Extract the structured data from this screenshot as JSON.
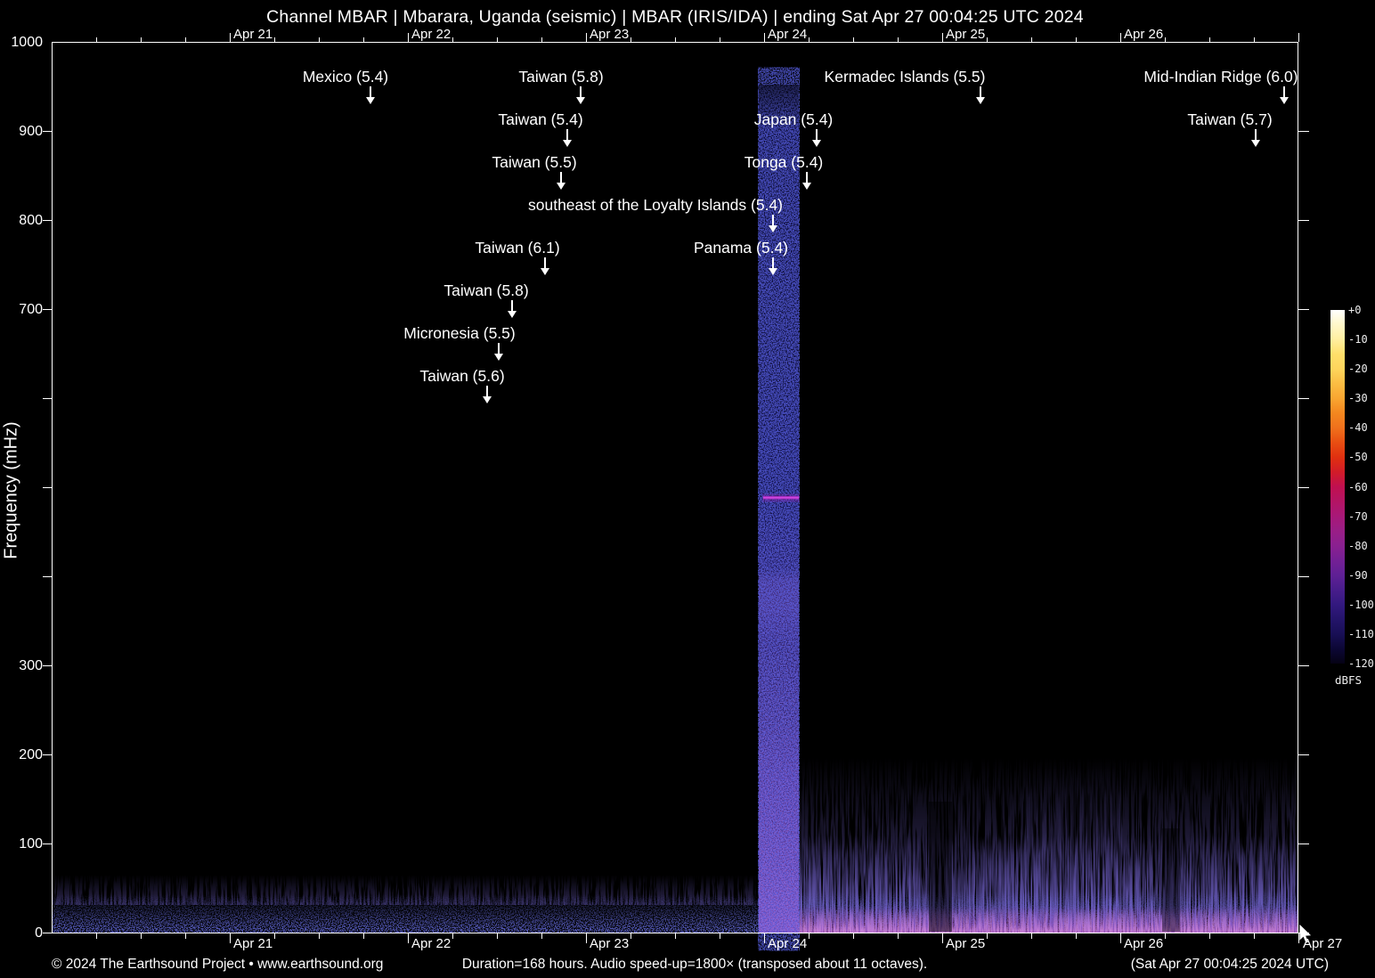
{
  "title": "Channel MBAR | Mbarara, Uganda (seismic) | MBAR (IRIS/IDA) | ending Sat Apr 27 00:04:25 UTC 2024",
  "y_axis": {
    "label": "Frequency (mHz)",
    "ticks": [
      "1000",
      "900",
      "800",
      "700",
      "300",
      "200",
      "100",
      "0"
    ]
  },
  "x_axis": {
    "top_dates": [
      "Apr 21",
      "Apr 22",
      "Apr 23",
      "Apr 24",
      "Apr 25",
      "Apr 26"
    ],
    "bottom_dates": [
      "Apr 21",
      "Apr 22",
      "Apr 23",
      "Apr 24",
      "Apr 25",
      "Apr 26",
      "Apr 27"
    ]
  },
  "colorbar": {
    "labels": [
      "+0",
      "-10",
      "-20",
      "-30",
      "-40",
      "-50",
      "-60",
      "-70",
      "-80",
      "-90",
      "-100",
      "-110",
      "-120"
    ],
    "unit": "dBFS"
  },
  "annotations": [
    {
      "label": "Mexico (5.4)"
    },
    {
      "label": "Taiwan (5.8)"
    },
    {
      "label": "Kermadec Islands (5.5)"
    },
    {
      "label": "Mid-Indian Ridge (6.0)"
    },
    {
      "label": "Taiwan (5.4)"
    },
    {
      "label": "Japan (5.4)"
    },
    {
      "label": "Taiwan (5.7)"
    },
    {
      "label": "Taiwan (5.5)"
    },
    {
      "label": "Tonga (5.4)"
    },
    {
      "label": "southeast of the Loyalty Islands (5.4)"
    },
    {
      "label": "Taiwan (6.1)"
    },
    {
      "label": "Panama (5.4)"
    },
    {
      "label": "Taiwan (5.8)"
    },
    {
      "label": "Micronesia (5.5)"
    },
    {
      "label": "Taiwan (5.6)"
    }
  ],
  "footer": {
    "left": "© 2024 The Earthsound Project • www.earthsound.org",
    "center": "Duration=168 hours. Audio speed-up=1800× (transposed about 11 octaves).",
    "right": "(Sat Apr 27 00:04:25 2024 UTC)"
  },
  "colors": {
    "background": "#000000",
    "axis_and_text": "#ffffff",
    "band_blue": "#131348",
    "band_purple": "#5f3a9c",
    "tone_magenta": "#b32fc4",
    "noise_blue": "#2429c7",
    "noise_pink_base": "#b75ab8"
  },
  "chart_data": {
    "type": "heatmap",
    "subtype": "audio-spectrogram",
    "title": "Channel MBAR | Mbarara, Uganda (seismic) | MBAR (IRIS/IDA) | ending Sat Apr 27 00:04:25 UTC 2024",
    "xlabel": "time (UTC), top/bottom date ticks Apr 21 - Apr 27 2024",
    "ylabel": "Frequency (mHz)",
    "ylim": [
      0,
      1000
    ],
    "x_range": [
      "Apr 20 00:04:25 UTC 2024",
      "Apr 27 00:04:25 UTC 2024"
    ],
    "duration_hours": 168,
    "speed_up": "1800×",
    "colorbar": {
      "unit": "dBFS",
      "range_db": [
        -120,
        0
      ],
      "scale": "white-yellow-orange-red-magenta-purple-blue-black"
    },
    "grid": false,
    "events": [
      {
        "label": "Mexico (5.4)",
        "magnitude": 5.4,
        "approx_time_utc": "Apr 21 ~19:00"
      },
      {
        "label": "Taiwan (5.8)",
        "magnitude": 5.8,
        "approx_time_utc": "Apr 22 ~23:15"
      },
      {
        "label": "Kermadec Islands (5.5)",
        "magnitude": 5.5,
        "approx_time_utc": "Apr 25 ~05:00"
      },
      {
        "label": "Mid-Indian Ridge (6.0)",
        "magnitude": 6.0,
        "approx_time_utc": "Apr 26 ~22:00"
      },
      {
        "label": "Taiwan (5.4)",
        "magnitude": 5.4,
        "approx_time_utc": "Apr 22 ~21:25"
      },
      {
        "label": "Japan (5.4)",
        "magnitude": 5.4,
        "approx_time_utc": "Apr 24 ~07:00"
      },
      {
        "label": "Taiwan (5.7)",
        "magnitude": 5.7,
        "approx_time_utc": "Apr 26 ~18:10"
      },
      {
        "label": "Taiwan (5.5)",
        "magnitude": 5.5,
        "approx_time_utc": "Apr 22 ~20:35"
      },
      {
        "label": "Tonga (5.4)",
        "magnitude": 5.4,
        "approx_time_utc": "Apr 24 ~05:40"
      },
      {
        "label": "southeast of the Loyalty Islands (5.4)",
        "magnitude": 5.4,
        "approx_time_utc": "Apr 24 ~01:10"
      },
      {
        "label": "Taiwan (6.1)",
        "magnitude": 6.1,
        "approx_time_utc": "Apr 22 ~18:25"
      },
      {
        "label": "Panama (5.4)",
        "magnitude": 5.4,
        "approx_time_utc": "Apr 24 ~01:10"
      },
      {
        "label": "Taiwan (5.8)",
        "magnitude": 5.8,
        "approx_time_utc": "Apr 22 ~14:00"
      },
      {
        "label": "Micronesia (5.5)",
        "magnitude": 5.5,
        "approx_time_utc": "Apr 22 ~12:10"
      },
      {
        "label": "Taiwan (5.6)",
        "magnitude": 5.6,
        "approx_time_utc": "Apr 22 ~10:30"
      }
    ],
    "features": [
      {
        "desc": "Broadband vertical energy band spanning 0-1000 mHz, approx Apr 23 23:10 to Apr 24 04:40 UTC (blue-purple, brighter below ~400 mHz)"
      },
      {
        "desc": "Narrowband magenta tone at ~490 mHz during the Apr 24 band"
      },
      {
        "desc": "Continuous dark-blue microseism noise below ~50 mHz across the whole week"
      },
      {
        "desc": "Elevated streaky noise below ~120 mHz with pink-magenta base from Apr 24 through Apr 27"
      }
    ]
  }
}
